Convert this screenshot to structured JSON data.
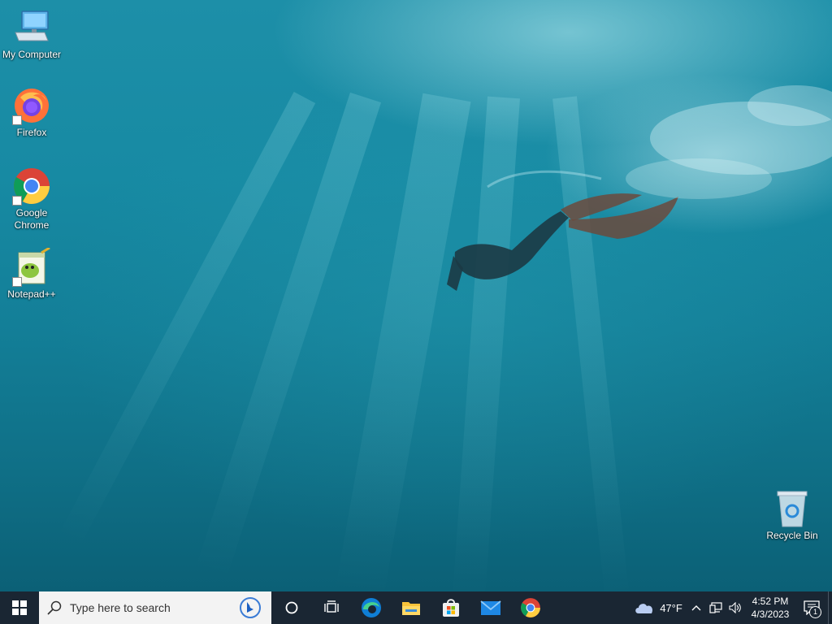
{
  "desktop": {
    "icons": [
      {
        "label": "My Computer",
        "icon": "computer-icon"
      },
      {
        "label": "Firefox",
        "icon": "firefox-icon"
      },
      {
        "label": "Google Chrome",
        "icon": "chrome-icon"
      },
      {
        "label": "Notepad++",
        "icon": "notepadpp-icon"
      },
      {
        "label": "Recycle Bin",
        "icon": "recycle-bin-icon"
      }
    ]
  },
  "taskbar": {
    "search": {
      "placeholder": "Type here to search"
    },
    "pinned": [
      {
        "name": "Cortana",
        "icon": "cortana-icon"
      },
      {
        "name": "Task View",
        "icon": "task-view-icon"
      },
      {
        "name": "Microsoft Edge",
        "icon": "edge-icon"
      },
      {
        "name": "File Explorer",
        "icon": "file-explorer-icon"
      },
      {
        "name": "Microsoft Store",
        "icon": "store-icon"
      },
      {
        "name": "Mail",
        "icon": "mail-icon"
      },
      {
        "name": "Google Chrome",
        "icon": "chrome-icon"
      }
    ],
    "tray": {
      "weather_temp": "47°F",
      "time": "4:52 PM",
      "date": "4/3/2023",
      "notification_count": "1"
    }
  },
  "colors": {
    "taskbar_bg": "#1a2633",
    "search_bg": "#f3f3f3",
    "accent_blue": "#0078d4"
  }
}
